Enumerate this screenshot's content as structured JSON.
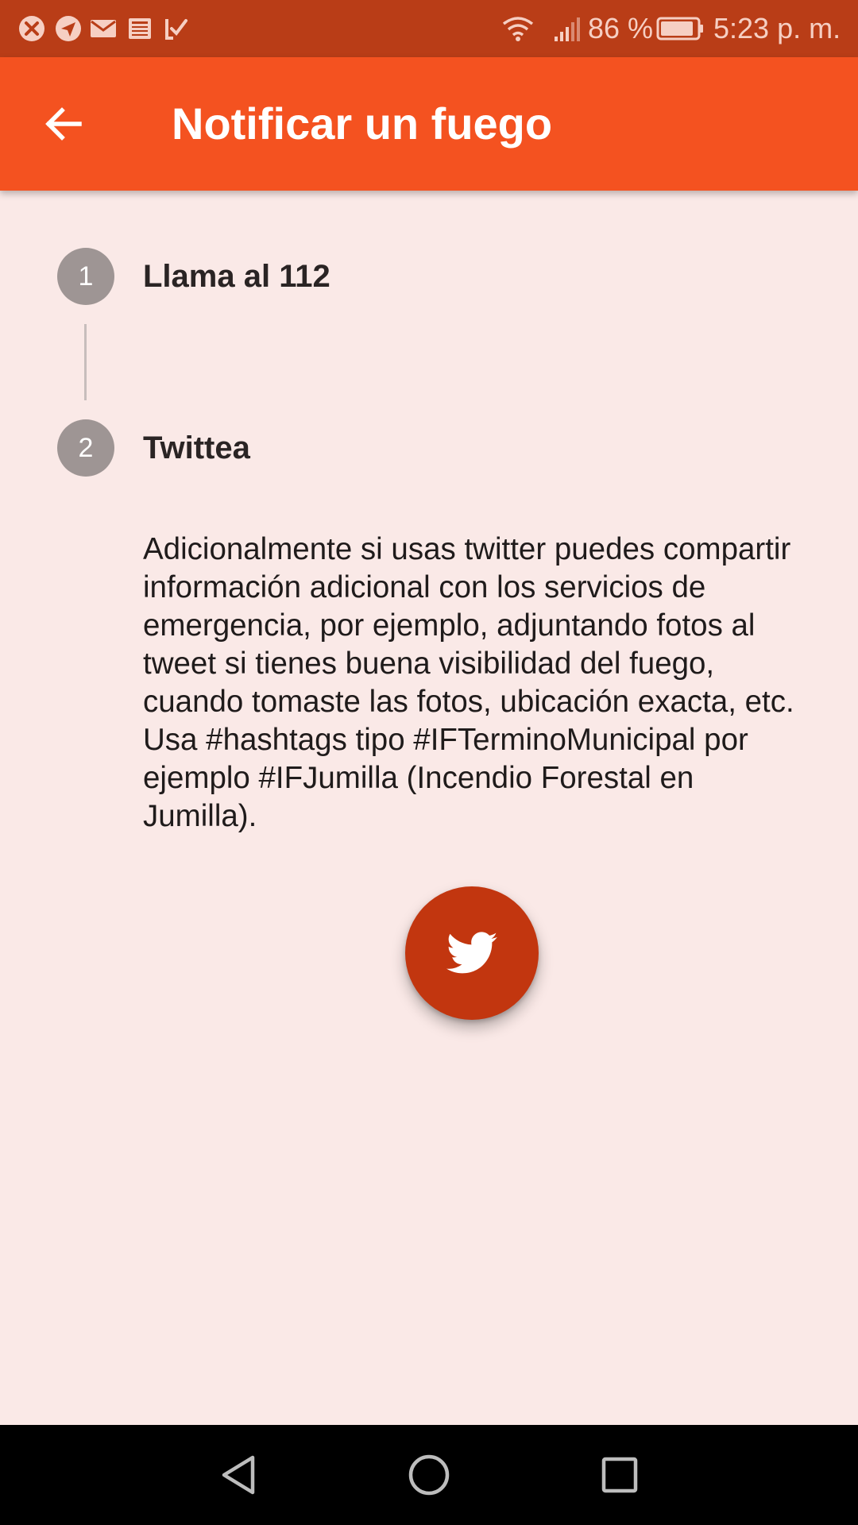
{
  "status_bar": {
    "battery_percent": "86 %",
    "time": "5:23 p. m.",
    "left_icons": [
      "close-circle-icon",
      "send-icon",
      "mail-icon",
      "news-icon",
      "check-icon"
    ],
    "right_icons": [
      "wifi-icon",
      "signal-icon",
      "battery-icon"
    ]
  },
  "app_bar": {
    "title": "Notificar un fuego",
    "back_icon": "arrow-back-icon"
  },
  "steps": [
    {
      "number": "1",
      "title": "Llama al 112"
    },
    {
      "number": "2",
      "title": "Twittea",
      "content": "Adicionalmente si usas twitter puedes compartir información adicional con los servicios de emergencia, por ejemplo, adjuntando fotos al tweet si tienes buena visibilidad del fuego, cuando tomaste las fotos, ubicación exacta, etc. Usa #hashtags tipo #IFTerminoMunicipal por ejemplo #IFJumilla (Incendio Forestal en Jumilla)."
    }
  ],
  "twitter_button": {
    "icon": "twitter-bird-icon"
  },
  "nav_bar": {
    "icons": [
      "back-triangle-icon",
      "home-circle-icon",
      "recents-square-icon"
    ]
  },
  "colors": {
    "status_bar": "#b93d17",
    "app_bar": "#f45220",
    "background": "#fae9e7",
    "step_circle": "#9e9594",
    "fab": "#c2360f"
  }
}
